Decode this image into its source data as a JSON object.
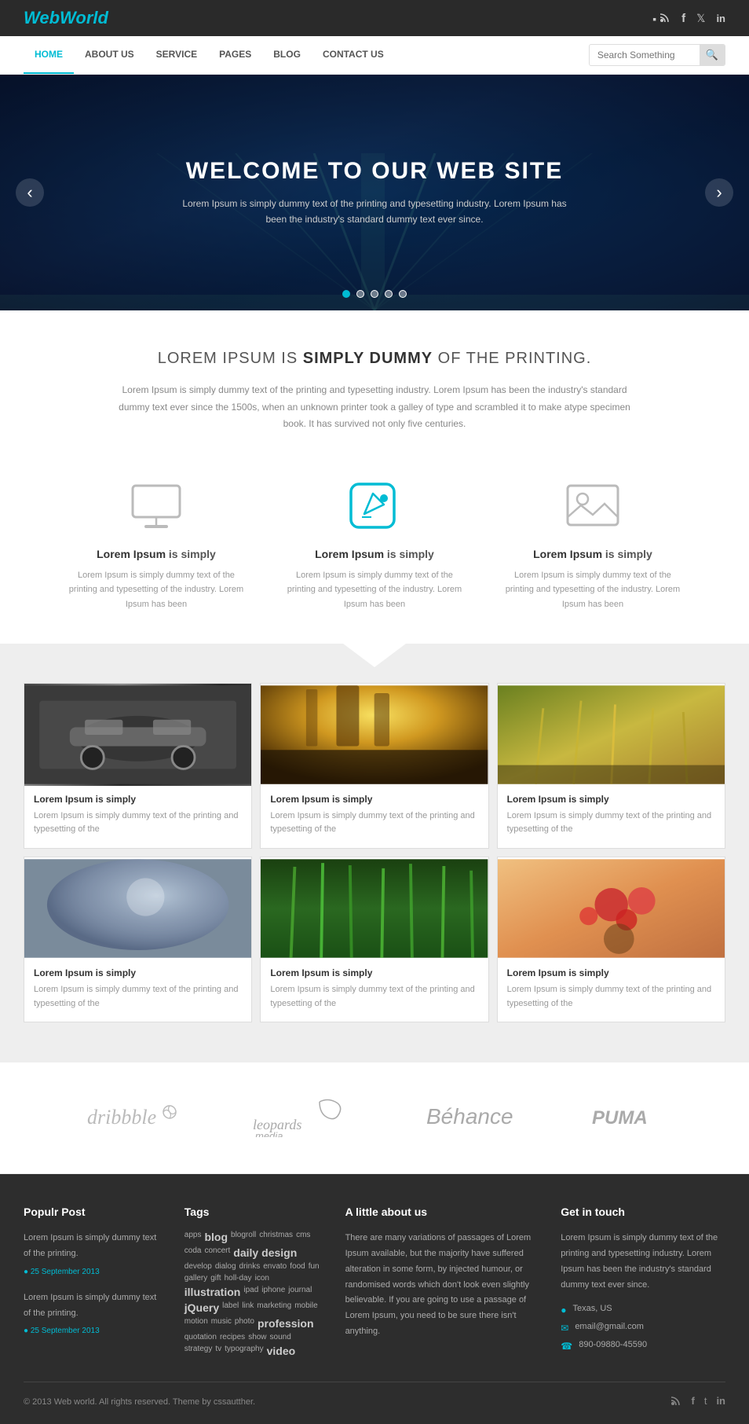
{
  "header": {
    "logo_web": "Web",
    "logo_world": "World",
    "social": [
      "rss",
      "facebook",
      "twitter",
      "linkedin"
    ]
  },
  "nav": {
    "items": [
      {
        "label": "HOME",
        "active": true
      },
      {
        "label": "ABOUT US",
        "active": false
      },
      {
        "label": "SERVICE",
        "active": false
      },
      {
        "label": "PAGES",
        "active": false
      },
      {
        "label": "BLOG",
        "active": false
      },
      {
        "label": "CONTACT US",
        "active": false
      }
    ],
    "search_placeholder": "Search Something"
  },
  "hero": {
    "title": "WELCOME TO OUR WEB SITE",
    "description": "Lorem Ipsum is simply dummy text of the printing and typesetting industry. Lorem Ipsum has been the industry's standard dummy text ever since.",
    "dots": 5
  },
  "intro": {
    "heading_normal": "LOREM IPSUM IS ",
    "heading_bold": "SIMPLY DUMMY",
    "heading_end": " OF THE PRINTING.",
    "body": "Lorem Ipsum is simply dummy text of the printing and typesetting industry. Lorem Ipsum has been the industry's standard dummy text ever since the 1500s, when an unknown printer took a galley of type and scrambled it to make atype specimen book. It has survived not only five centuries."
  },
  "features": [
    {
      "icon": "monitor",
      "title_bold": "Lorem Ipsum",
      "title_rest": " is simply",
      "desc": "Lorem Ipsum is simply dummy text of the printing and typesetting of the industry. Lorem Ipsum has been"
    },
    {
      "icon": "edit",
      "title_bold": "Lorem Ipsum",
      "title_rest": " is simply",
      "desc": "Lorem Ipsum is simply dummy text of the printing and typesetting of the industry. Lorem Ipsum has been"
    },
    {
      "icon": "image",
      "title_bold": "Lorem Ipsum",
      "title_rest": " is simply",
      "desc": "Lorem Ipsum is simply dummy text of the printing and typesetting of the industry. Lorem Ipsum has been"
    }
  ],
  "portfolio": {
    "cards": [
      {
        "img_class": "img-car",
        "title": "Lorem Ipsum is simply",
        "desc": "Lorem Ipsum is simply dummy text of the printing and typesetting of the"
      },
      {
        "img_class": "img-forest",
        "title": "Lorem Ipsum is simply",
        "desc": "Lorem Ipsum is simply dummy text of the printing and typesetting of the"
      },
      {
        "img_class": "img-wheat",
        "title": "Lorem Ipsum is simply",
        "desc": "Lorem Ipsum is simply dummy text of the printing and typesetting of the"
      },
      {
        "img_class": "img-blur",
        "title": "Lorem Ipsum is simply",
        "desc": "Lorem Ipsum is simply dummy text of the printing and typesetting of the"
      },
      {
        "img_class": "img-green",
        "title": "Lorem Ipsum is simply",
        "desc": "Lorem Ipsum is simply dummy text of the printing and typesetting of the"
      },
      {
        "img_class": "img-berries",
        "title": "Lorem Ipsum is simply",
        "desc": "Lorem Ipsum is simply dummy text of the printing and typesetting of the"
      }
    ]
  },
  "partners": [
    {
      "name": "dribbble",
      "style": "italic"
    },
    {
      "name": "leopards media",
      "style": "normal"
    },
    {
      "name": "Behance",
      "style": "normal"
    },
    {
      "name": "PUMA",
      "style": "normal"
    }
  ],
  "footer": {
    "popular_post_title": "Populr Post",
    "posts": [
      {
        "text": "Lorem Ipsum is simply dummy text of the printing.",
        "date": "25 September 2013"
      },
      {
        "text": "Lorem Ipsum is simply dummy text of the printing.",
        "date": "25 September 2013"
      }
    ],
    "tags_title": "Tags",
    "tags": [
      {
        "text": "apps",
        "size": "normal"
      },
      {
        "text": "blog",
        "size": "large"
      },
      {
        "text": "blogroll",
        "size": "normal"
      },
      {
        "text": "christmas",
        "size": "normal"
      },
      {
        "text": "cms",
        "size": "normal"
      },
      {
        "text": "coda",
        "size": "normal"
      },
      {
        "text": "concert",
        "size": "normal"
      },
      {
        "text": "daily",
        "size": "large"
      },
      {
        "text": "design",
        "size": "large"
      },
      {
        "text": "develop",
        "size": "normal"
      },
      {
        "text": "dialog",
        "size": "normal"
      },
      {
        "text": "drinks",
        "size": "normal"
      },
      {
        "text": "envato",
        "size": "normal"
      },
      {
        "text": "food",
        "size": "normal"
      },
      {
        "text": "fun",
        "size": "normal"
      },
      {
        "text": "gallery",
        "size": "normal"
      },
      {
        "text": "gift",
        "size": "normal"
      },
      {
        "text": "holiday",
        "size": "normal"
      },
      {
        "text": "icon",
        "size": "normal"
      },
      {
        "text": "illustration",
        "size": "large"
      },
      {
        "text": "ipad",
        "size": "normal"
      },
      {
        "text": "iphone",
        "size": "normal"
      },
      {
        "text": "journal",
        "size": "normal"
      },
      {
        "text": "jQuery",
        "size": "large"
      },
      {
        "text": "label",
        "size": "normal"
      },
      {
        "text": "link",
        "size": "normal"
      },
      {
        "text": "marketing",
        "size": "normal"
      },
      {
        "text": "mobile",
        "size": "normal"
      },
      {
        "text": "motion",
        "size": "normal"
      },
      {
        "text": "music",
        "size": "normal"
      },
      {
        "text": "photo",
        "size": "normal"
      },
      {
        "text": "profession",
        "size": "large"
      },
      {
        "text": "quotation",
        "size": "normal"
      },
      {
        "text": "recipes",
        "size": "normal"
      },
      {
        "text": "show",
        "size": "normal"
      },
      {
        "text": "sound",
        "size": "normal"
      },
      {
        "text": "strategy",
        "size": "normal"
      },
      {
        "text": "tv",
        "size": "normal"
      },
      {
        "text": "typography",
        "size": "normal"
      },
      {
        "text": "video",
        "size": "large"
      }
    ],
    "about_title": "A little about us",
    "about_text": "There are many variations of passages of Lorem Ipsum available, but the majority have suffered alteration in some form, by injected humour, or randomised words which don't look even slightly believable. If you are going to use a passage of Lorem Ipsum, you need to be sure there isn't anything.",
    "contact_title": "Get in touch",
    "contact_desc": "Lorem Ipsum is simply dummy text of the printing and typesetting industry. Lorem Ipsum has been the industry's standard dummy text ever since.",
    "contact_items": [
      {
        "icon": "location",
        "text": "Texas, US"
      },
      {
        "icon": "email",
        "text": "email@gmail.com"
      },
      {
        "icon": "phone",
        "text": "890-09880-45590"
      }
    ],
    "copyright": "© 2013 Web world. All rights reserved. Theme by cssautther."
  }
}
